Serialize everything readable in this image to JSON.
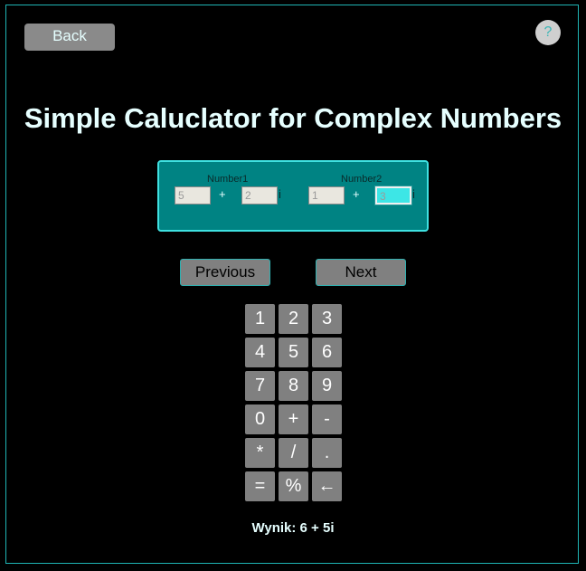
{
  "header": {
    "back_label": "Back",
    "help_label": "?"
  },
  "title": "Simple Caluclator for Complex Numbers",
  "number1": {
    "label": "Number1",
    "real": "5",
    "plus": "+",
    "imag": "2",
    "i": "i"
  },
  "number2": {
    "label": "Number2",
    "real": "1",
    "plus": "+",
    "imag": "3",
    "i": "i"
  },
  "nav": {
    "previous_label": "Previous",
    "next_label": "Next"
  },
  "keypad": {
    "keys": [
      "1",
      "2",
      "3",
      "4",
      "5",
      "6",
      "7",
      "8",
      "9",
      "0",
      "+",
      "-",
      "*",
      "/",
      ".",
      "=",
      "%",
      "←"
    ]
  },
  "result": "Wynik: 6 + 5i",
  "colors": {
    "background": "#000000",
    "accent": "#1fb5b5",
    "panel": "#008383",
    "active_input": "#3de6e6",
    "key": "#808080"
  }
}
